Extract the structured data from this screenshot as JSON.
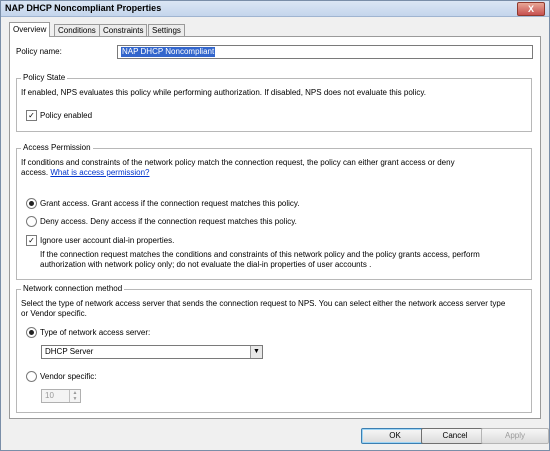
{
  "window": {
    "title": "NAP DHCP Noncompliant Properties",
    "close_glyph": "X"
  },
  "tabs": [
    {
      "label": "Overview",
      "active": true
    },
    {
      "label": "Conditions",
      "active": false
    },
    {
      "label": "Constraints",
      "active": false
    },
    {
      "label": "Settings",
      "active": false
    }
  ],
  "overview": {
    "policy_name_label": "Policy name:",
    "policy_name_value": "NAP DHCP Noncompliant",
    "policy_state": {
      "legend": "Policy State",
      "description": "If enabled, NPS evaluates this policy while performing authorization. If disabled, NPS does not evaluate this policy.",
      "enabled_label": "Policy enabled",
      "enabled_checked": true
    },
    "access_permission": {
      "legend": "Access Permission",
      "description_line1": "If conditions and constraints of the network policy match the connection request, the policy can either grant access or deny",
      "description_line2": "access.",
      "link": "What is access permission?",
      "grant_label": "Grant access. Grant access if the connection request matches this policy.",
      "grant_selected": true,
      "deny_label": "Deny access. Deny access if the connection request matches this policy.",
      "deny_selected": false,
      "ignore_label": "Ignore user account dial-in properties.",
      "ignore_checked": true,
      "ignore_desc_line1": "If the connection request matches the conditions and constraints of this network policy and the policy grants access, perform",
      "ignore_desc_line2": "authorization with network policy only; do not evaluate the dial-in properties of user accounts ."
    },
    "network_connection": {
      "legend": "Network connection method",
      "description_line1": "Select the type of network access server that sends the connection request to NPS. You can select either the network access server type",
      "description_line2": "or Vendor specific.",
      "type_label": "Type of network access server:",
      "type_selected": true,
      "type_value": "DHCP Server",
      "vendor_label": "Vendor specific:",
      "vendor_selected": false,
      "vendor_value": "10"
    }
  },
  "buttons": {
    "ok": "OK",
    "cancel": "Cancel",
    "apply": "Apply"
  },
  "glyphs": {
    "check": "✓",
    "dropdown": "▼",
    "spin_up": "▲",
    "spin_down": "▼"
  }
}
